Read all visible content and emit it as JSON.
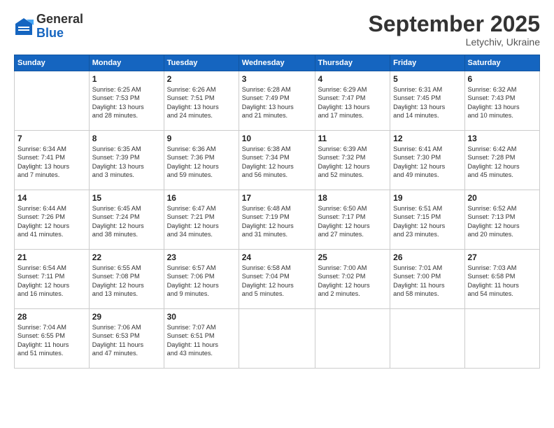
{
  "logo": {
    "general": "General",
    "blue": "Blue"
  },
  "header": {
    "month": "September 2025",
    "location": "Letychiv, Ukraine"
  },
  "weekdays": [
    "Sunday",
    "Monday",
    "Tuesday",
    "Wednesday",
    "Thursday",
    "Friday",
    "Saturday"
  ],
  "weeks": [
    [
      {
        "day": "",
        "info": ""
      },
      {
        "day": "1",
        "info": "Sunrise: 6:25 AM\nSunset: 7:53 PM\nDaylight: 13 hours\nand 28 minutes."
      },
      {
        "day": "2",
        "info": "Sunrise: 6:26 AM\nSunset: 7:51 PM\nDaylight: 13 hours\nand 24 minutes."
      },
      {
        "day": "3",
        "info": "Sunrise: 6:28 AM\nSunset: 7:49 PM\nDaylight: 13 hours\nand 21 minutes."
      },
      {
        "day": "4",
        "info": "Sunrise: 6:29 AM\nSunset: 7:47 PM\nDaylight: 13 hours\nand 17 minutes."
      },
      {
        "day": "5",
        "info": "Sunrise: 6:31 AM\nSunset: 7:45 PM\nDaylight: 13 hours\nand 14 minutes."
      },
      {
        "day": "6",
        "info": "Sunrise: 6:32 AM\nSunset: 7:43 PM\nDaylight: 13 hours\nand 10 minutes."
      }
    ],
    [
      {
        "day": "7",
        "info": "Sunrise: 6:34 AM\nSunset: 7:41 PM\nDaylight: 13 hours\nand 7 minutes."
      },
      {
        "day": "8",
        "info": "Sunrise: 6:35 AM\nSunset: 7:39 PM\nDaylight: 13 hours\nand 3 minutes."
      },
      {
        "day": "9",
        "info": "Sunrise: 6:36 AM\nSunset: 7:36 PM\nDaylight: 12 hours\nand 59 minutes."
      },
      {
        "day": "10",
        "info": "Sunrise: 6:38 AM\nSunset: 7:34 PM\nDaylight: 12 hours\nand 56 minutes."
      },
      {
        "day": "11",
        "info": "Sunrise: 6:39 AM\nSunset: 7:32 PM\nDaylight: 12 hours\nand 52 minutes."
      },
      {
        "day": "12",
        "info": "Sunrise: 6:41 AM\nSunset: 7:30 PM\nDaylight: 12 hours\nand 49 minutes."
      },
      {
        "day": "13",
        "info": "Sunrise: 6:42 AM\nSunset: 7:28 PM\nDaylight: 12 hours\nand 45 minutes."
      }
    ],
    [
      {
        "day": "14",
        "info": "Sunrise: 6:44 AM\nSunset: 7:26 PM\nDaylight: 12 hours\nand 41 minutes."
      },
      {
        "day": "15",
        "info": "Sunrise: 6:45 AM\nSunset: 7:24 PM\nDaylight: 12 hours\nand 38 minutes."
      },
      {
        "day": "16",
        "info": "Sunrise: 6:47 AM\nSunset: 7:21 PM\nDaylight: 12 hours\nand 34 minutes."
      },
      {
        "day": "17",
        "info": "Sunrise: 6:48 AM\nSunset: 7:19 PM\nDaylight: 12 hours\nand 31 minutes."
      },
      {
        "day": "18",
        "info": "Sunrise: 6:50 AM\nSunset: 7:17 PM\nDaylight: 12 hours\nand 27 minutes."
      },
      {
        "day": "19",
        "info": "Sunrise: 6:51 AM\nSunset: 7:15 PM\nDaylight: 12 hours\nand 23 minutes."
      },
      {
        "day": "20",
        "info": "Sunrise: 6:52 AM\nSunset: 7:13 PM\nDaylight: 12 hours\nand 20 minutes."
      }
    ],
    [
      {
        "day": "21",
        "info": "Sunrise: 6:54 AM\nSunset: 7:11 PM\nDaylight: 12 hours\nand 16 minutes."
      },
      {
        "day": "22",
        "info": "Sunrise: 6:55 AM\nSunset: 7:08 PM\nDaylight: 12 hours\nand 13 minutes."
      },
      {
        "day": "23",
        "info": "Sunrise: 6:57 AM\nSunset: 7:06 PM\nDaylight: 12 hours\nand 9 minutes."
      },
      {
        "day": "24",
        "info": "Sunrise: 6:58 AM\nSunset: 7:04 PM\nDaylight: 12 hours\nand 5 minutes."
      },
      {
        "day": "25",
        "info": "Sunrise: 7:00 AM\nSunset: 7:02 PM\nDaylight: 12 hours\nand 2 minutes."
      },
      {
        "day": "26",
        "info": "Sunrise: 7:01 AM\nSunset: 7:00 PM\nDaylight: 11 hours\nand 58 minutes."
      },
      {
        "day": "27",
        "info": "Sunrise: 7:03 AM\nSunset: 6:58 PM\nDaylight: 11 hours\nand 54 minutes."
      }
    ],
    [
      {
        "day": "28",
        "info": "Sunrise: 7:04 AM\nSunset: 6:55 PM\nDaylight: 11 hours\nand 51 minutes."
      },
      {
        "day": "29",
        "info": "Sunrise: 7:06 AM\nSunset: 6:53 PM\nDaylight: 11 hours\nand 47 minutes."
      },
      {
        "day": "30",
        "info": "Sunrise: 7:07 AM\nSunset: 6:51 PM\nDaylight: 11 hours\nand 43 minutes."
      },
      {
        "day": "",
        "info": ""
      },
      {
        "day": "",
        "info": ""
      },
      {
        "day": "",
        "info": ""
      },
      {
        "day": "",
        "info": ""
      }
    ]
  ]
}
